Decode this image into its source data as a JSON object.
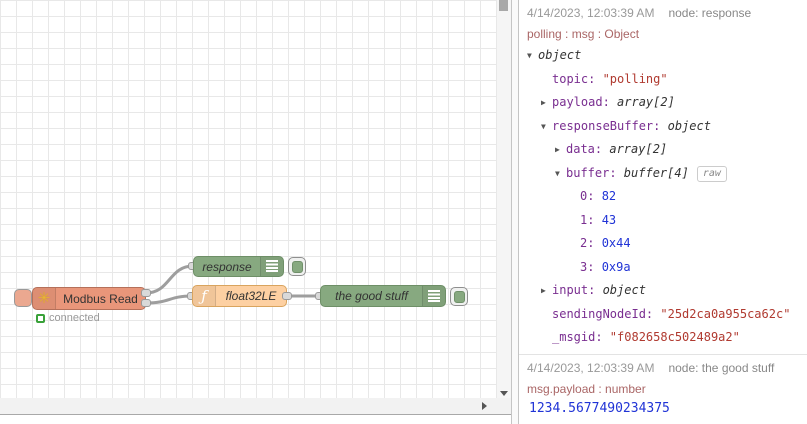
{
  "colors": {
    "modbus_node": "#e9967a",
    "debug_node": "#87a980",
    "function_node": "#fdd0a2",
    "wire": "#9e9e9e",
    "json_key": "#792e90",
    "json_string": "#b03a30",
    "json_number": "#2033d6"
  },
  "canvas": {
    "modbus": {
      "label": "Modbus Read",
      "icon": "✳",
      "status": "connected"
    },
    "response": {
      "label": "response"
    },
    "function": {
      "label": "float32LE",
      "icon": "ƒ"
    },
    "goodstuff": {
      "label": "the good stuff"
    }
  },
  "sidebar": {
    "messages": [
      {
        "timestamp": "4/14/2023, 12:03:39 AM",
        "node": "node: response",
        "topic": "polling : msg : Object",
        "tree": [
          {
            "indent": 0,
            "arrow": "down",
            "value": "object",
            "vtype": "type"
          },
          {
            "indent": 1,
            "key": "topic",
            "value": "\"polling\"",
            "vtype": "string"
          },
          {
            "indent": 1,
            "arrow": "right",
            "key": "payload",
            "value": "array[2]",
            "vtype": "type"
          },
          {
            "indent": 1,
            "arrow": "down",
            "key": "responseBuffer",
            "value": "object",
            "vtype": "type"
          },
          {
            "indent": 2,
            "arrow": "right",
            "key": "data",
            "value": "array[2]",
            "vtype": "type"
          },
          {
            "indent": 2,
            "arrow": "down",
            "key": "buffer",
            "value": "buffer[4]",
            "vtype": "type",
            "button": "raw"
          },
          {
            "indent": 3,
            "key": "0",
            "value": "82",
            "vtype": "number"
          },
          {
            "indent": 3,
            "key": "1",
            "value": "43",
            "vtype": "number"
          },
          {
            "indent": 3,
            "key": "2",
            "value": "0x44",
            "vtype": "number"
          },
          {
            "indent": 3,
            "key": "3",
            "value": "0x9a",
            "vtype": "number"
          },
          {
            "indent": 1,
            "arrow": "right",
            "key": "input",
            "value": "object",
            "vtype": "type"
          },
          {
            "indent": 1,
            "key": "sendingNodeId",
            "value": "\"25d2ca0a955ca62c\"",
            "vtype": "string"
          },
          {
            "indent": 1,
            "key": "_msgid",
            "value": "\"f082658c502489a2\"",
            "vtype": "string"
          }
        ]
      },
      {
        "timestamp": "4/14/2023, 12:03:39 AM",
        "node": "node: the good stuff",
        "topic": "msg.payload : number",
        "value": "1234.5677490234375"
      }
    ]
  }
}
